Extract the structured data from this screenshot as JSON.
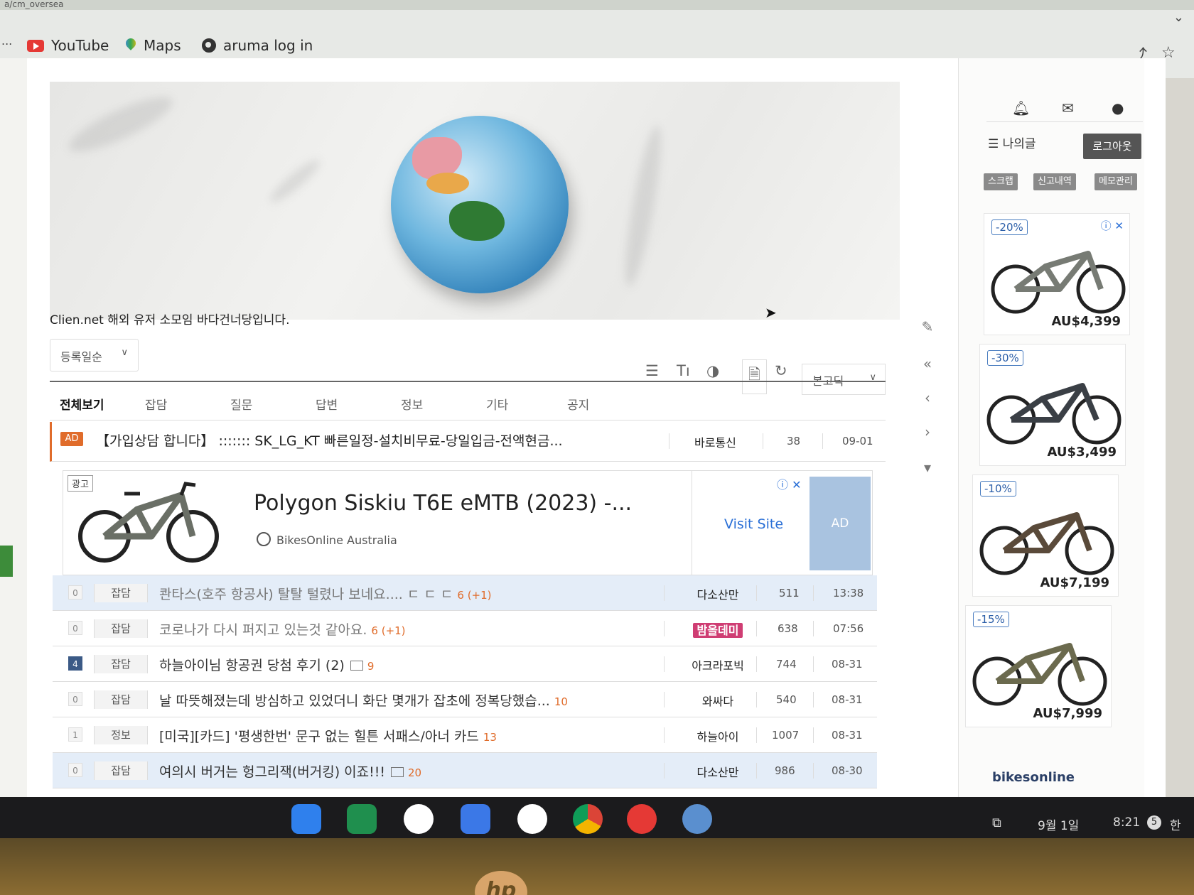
{
  "browser": {
    "url_fragment": "a/cm_oversea",
    "bookmarks": [
      {
        "label": "YouTube",
        "icon": "youtube-icon"
      },
      {
        "label": "Maps",
        "icon": "maps-icon"
      },
      {
        "label": "aruma log in",
        "icon": "globe-icon"
      }
    ],
    "bookmarks_more": "..."
  },
  "board": {
    "intro": "Clien.net 해외 유저 소모임 바다건너당입니다.",
    "sort_label": "등록일순",
    "font_select": "본고딕",
    "tabs": [
      "전체보기",
      "잡담",
      "질문",
      "답변",
      "정보",
      "기타",
      "공지"
    ],
    "ad_row": {
      "badge": "AD",
      "title": "【가입상담 합니다】 ::::::: SK_LG_KT 빠른일정-설치비무료-당일입금-전액현금...",
      "author": "바로통신",
      "views": "38",
      "date": "09-01"
    },
    "ad_box": {
      "tag": "광고",
      "title": "Polygon Siskiu T6E eMTB (2023) -...",
      "source": "BikesOnline Australia",
      "cta": "Visit Site",
      "badge": "AD"
    },
    "posts": [
      {
        "num": "0",
        "cat": "잡담",
        "subject": "콴타스(호주 항공사) 탈탈 털렸나 보네요.... ㄷ ㄷ ㄷ",
        "comments": "6 (+1)",
        "author": "다소산만",
        "views": "511",
        "time": "13:38",
        "highlight": true,
        "image": false
      },
      {
        "num": "0",
        "cat": "잡담",
        "subject": "코로나가 다시 퍼지고 있는것 같아요.",
        "comments": "6 (+1)",
        "author": "밤올데미",
        "views": "638",
        "time": "07:56",
        "highlight": false,
        "image": false
      },
      {
        "num": "4",
        "cat": "잡담",
        "subject": "하늘아이님 항공권 당첨 후기 (2)",
        "comments": "9",
        "author": "아크라포빅",
        "views": "744",
        "time": "08-31",
        "highlight": false,
        "image": true
      },
      {
        "num": "0",
        "cat": "잡담",
        "subject": "날 따뜻해졌는데 방심하고 있었더니 화단 몇개가 잡초에 정복당했습...",
        "comments": "10",
        "author": "와싸다",
        "views": "540",
        "time": "08-31",
        "highlight": false,
        "image": false
      },
      {
        "num": "1",
        "cat": "정보",
        "subject": "[미국][카드] '평생한번' 문구 없는 힐튼 서패스/아너 카드",
        "comments": "13",
        "author": "하늘아이",
        "views": "1007",
        "time": "08-31",
        "highlight": false,
        "image": false
      },
      {
        "num": "0",
        "cat": "잡담",
        "subject": "여의시 버거는 헝그리잭(버거킹) 이죠!!!",
        "comments": "20",
        "author": "다소산만",
        "views": "986",
        "time": "08-30",
        "highlight": true,
        "image": true
      }
    ]
  },
  "sidebar": {
    "my_posts": "나의글",
    "logout": "로그아웃",
    "buttons": [
      "스크랩",
      "신고내역",
      "메모관리"
    ],
    "ads": [
      {
        "discount": "-20%",
        "price": "AU$4,399"
      },
      {
        "discount": "-30%",
        "price": "AU$3,499"
      },
      {
        "discount": "-10%",
        "price": "AU$7,199"
      },
      {
        "discount": "-15%",
        "price": "AU$7,999"
      }
    ],
    "brand": "bikesonline"
  },
  "shelf": {
    "date": "9월 1일",
    "time": "8:21",
    "badge": "5",
    "ime": "한"
  }
}
